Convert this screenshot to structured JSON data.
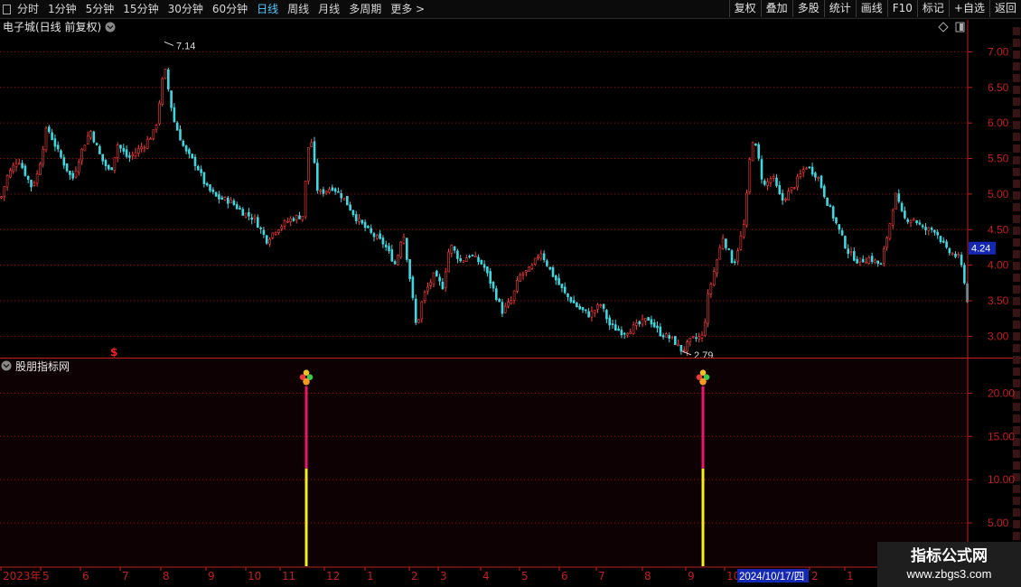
{
  "toolbar": {
    "periods": [
      "分时",
      "1分钟",
      "5分钟",
      "15分钟",
      "30分钟",
      "60分钟",
      "日线",
      "周线",
      "月线",
      "多周期",
      "更多 >"
    ],
    "active_period": "日线",
    "right_buttons": [
      "复权",
      "叠加",
      "多股",
      "统计",
      "画线",
      "F10",
      "标记",
      "+自选",
      "返回"
    ]
  },
  "main_panel": {
    "title": "电子城(日线 前复权)"
  },
  "indicator_panel": {
    "title": "股朋指标网"
  },
  "colors": {
    "up": "#ff3b3b",
    "down": "#3fd8e0",
    "grid": "#b00000",
    "axis": "#c41e1e",
    "price_box": "#1428b4",
    "bar_top": "#e8186c",
    "bar_bottom": "#f5f01a",
    "signal_arrow": "#ff2020"
  },
  "chart_data": [
    {
      "type": "candlestick",
      "title": "电子城(日线 前复权)",
      "y_ticks": [
        "7.00",
        "6.50",
        "6.00",
        "5.50",
        "5.00",
        "4.50",
        "4.00",
        "3.50",
        "3.00"
      ],
      "ylim": [
        2.7,
        7.45
      ],
      "current_price": "4.24",
      "annotations": [
        {
          "label": "7.14",
          "value": 7.14,
          "date": "2023-08"
        },
        {
          "label": "2.79",
          "value": 2.79,
          "date": "2024-09"
        }
      ],
      "signal_marker": {
        "label": "$",
        "date": "2023-07"
      },
      "close_path": [
        [
          0,
          4.9
        ],
        [
          8,
          5.25
        ],
        [
          20,
          5.5
        ],
        [
          35,
          5.1
        ],
        [
          42,
          5.3
        ],
        [
          52,
          5.95
        ],
        [
          64,
          5.6
        ],
        [
          80,
          5.2
        ],
        [
          90,
          5.6
        ],
        [
          100,
          5.9
        ],
        [
          112,
          5.5
        ],
        [
          122,
          5.3
        ],
        [
          130,
          5.7
        ],
        [
          142,
          5.5
        ],
        [
          160,
          5.7
        ],
        [
          172,
          5.9
        ],
        [
          182,
          6.8
        ],
        [
          192,
          6.05
        ],
        [
          205,
          5.6
        ],
        [
          218,
          5.4
        ],
        [
          228,
          5.1
        ],
        [
          240,
          4.95
        ],
        [
          255,
          4.9
        ],
        [
          268,
          4.75
        ],
        [
          282,
          4.65
        ],
        [
          295,
          4.35
        ],
        [
          305,
          4.5
        ],
        [
          322,
          4.65
        ],
        [
          335,
          4.7
        ],
        [
          343,
          5.9
        ],
        [
          352,
          5.0
        ],
        [
          368,
          5.1
        ],
        [
          380,
          4.95
        ],
        [
          395,
          4.65
        ],
        [
          410,
          4.45
        ],
        [
          425,
          4.3
        ],
        [
          438,
          4.0
        ],
        [
          446,
          4.5
        ],
        [
          455,
          3.7
        ],
        [
          461,
          3.1
        ],
        [
          468,
          3.55
        ],
        [
          480,
          3.85
        ],
        [
          490,
          3.7
        ],
        [
          498,
          4.3
        ],
        [
          510,
          4.05
        ],
        [
          520,
          4.15
        ],
        [
          535,
          4.0
        ],
        [
          548,
          3.6
        ],
        [
          556,
          3.35
        ],
        [
          566,
          3.5
        ],
        [
          575,
          3.85
        ],
        [
          588,
          3.95
        ],
        [
          598,
          4.2
        ],
        [
          610,
          3.9
        ],
        [
          625,
          3.6
        ],
        [
          640,
          3.4
        ],
        [
          652,
          3.3
        ],
        [
          665,
          3.45
        ],
        [
          675,
          3.15
        ],
        [
          690,
          3.05
        ],
        [
          705,
          3.15
        ],
        [
          718,
          3.25
        ],
        [
          730,
          3.05
        ],
        [
          745,
          2.95
        ],
        [
          755,
          2.79
        ],
        [
          765,
          2.95
        ],
        [
          778,
          3.0
        ],
        [
          784,
          3.6
        ],
        [
          792,
          4.0
        ],
        [
          800,
          4.4
        ],
        [
          812,
          4.0
        ],
        [
          824,
          4.6
        ],
        [
          832,
          5.8
        ],
        [
          838,
          5.6
        ],
        [
          845,
          5.1
        ],
        [
          855,
          5.25
        ],
        [
          865,
          4.9
        ],
        [
          878,
          5.1
        ],
        [
          892,
          5.4
        ],
        [
          905,
          5.25
        ],
        [
          915,
          4.9
        ],
        [
          925,
          4.6
        ],
        [
          938,
          4.2
        ],
        [
          950,
          4.05
        ],
        [
          962,
          4.1
        ],
        [
          975,
          4.0
        ],
        [
          985,
          4.6
        ],
        [
          991,
          5.0
        ],
        [
          1000,
          4.65
        ],
        [
          1012,
          4.65
        ],
        [
          1022,
          4.5
        ],
        [
          1035,
          4.5
        ],
        [
          1048,
          4.2
        ],
        [
          1062,
          4.1
        ],
        [
          1068,
          3.75
        ],
        [
          1071,
          3.45
        ]
      ]
    },
    {
      "type": "bar",
      "title": "股朋指标网",
      "y_ticks": [
        "20.00",
        "15.00",
        "10.00",
        "5.00"
      ],
      "ylim": [
        0,
        24
      ],
      "bars": [
        {
          "date": "2023-11",
          "total": 20.8,
          "lower": 11.3
        },
        {
          "date": "2024-09",
          "total": 20.8,
          "lower": 11.3
        }
      ]
    }
  ],
  "time_axis": {
    "labels": [
      {
        "text": "2023年",
        "x": 1
      },
      {
        "text": "5",
        "x": 45
      },
      {
        "text": "6",
        "x": 89
      },
      {
        "text": "7",
        "x": 133
      },
      {
        "text": "8",
        "x": 178
      },
      {
        "text": "9",
        "x": 228
      },
      {
        "text": "10",
        "x": 272
      },
      {
        "text": "11",
        "x": 310
      },
      {
        "text": "12",
        "x": 359
      },
      {
        "text": "1",
        "x": 404
      },
      {
        "text": "2",
        "x": 453
      },
      {
        "text": "3",
        "x": 485
      },
      {
        "text": "4",
        "x": 532
      },
      {
        "text": "5",
        "x": 575
      },
      {
        "text": "6",
        "x": 619
      },
      {
        "text": "7",
        "x": 660
      },
      {
        "text": "8",
        "x": 711
      },
      {
        "text": "9",
        "x": 759
      },
      {
        "text": "10",
        "x": 802
      },
      {
        "text": "2",
        "x": 896
      },
      {
        "text": "1",
        "x": 935
      }
    ],
    "highlight": "2024/10/17/四"
  },
  "watermark": {
    "title": "指标公式网",
    "url": "www.zbgs3.com"
  }
}
